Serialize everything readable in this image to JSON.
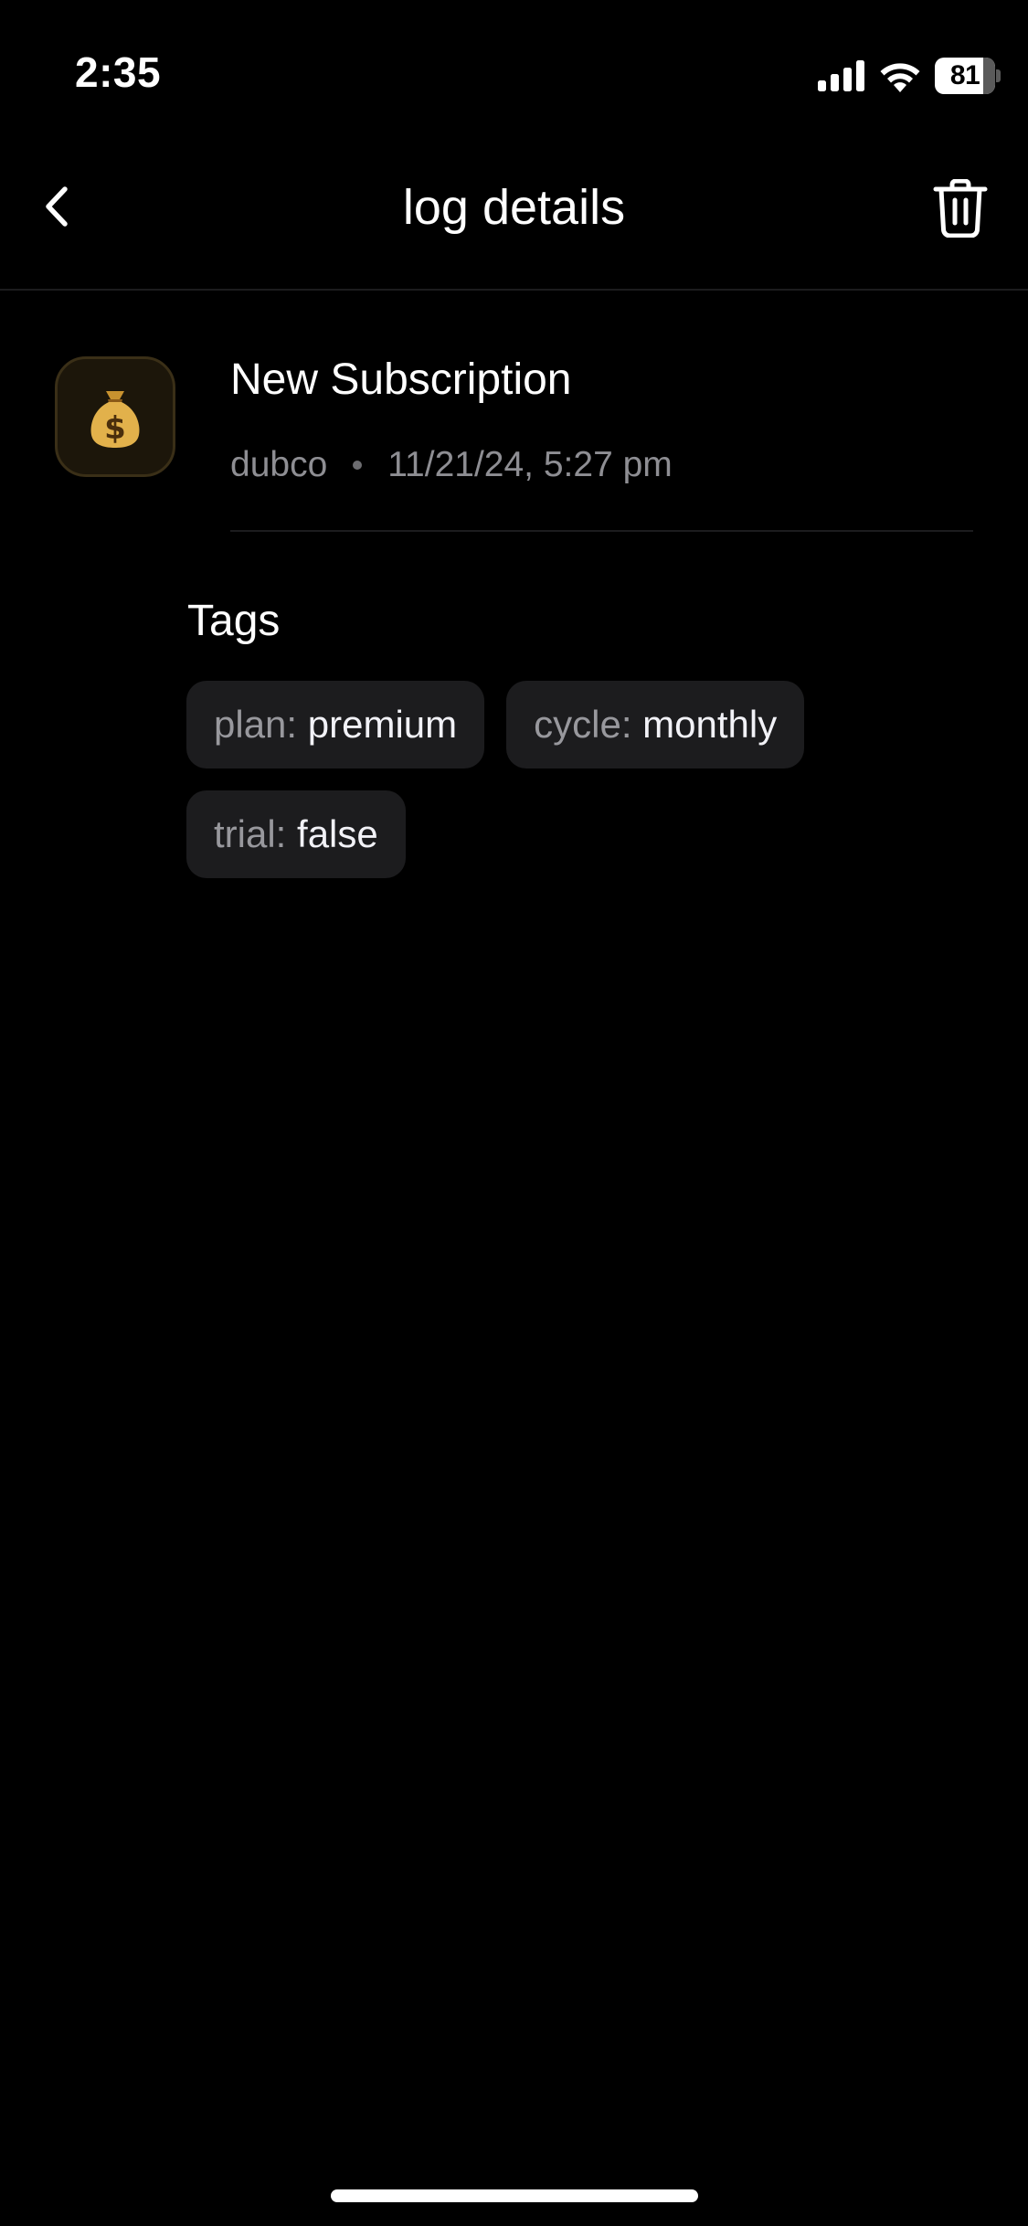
{
  "status_bar": {
    "time": "2:35",
    "battery_level": "81",
    "battery_fraction": 0.81,
    "icons": [
      "cellular-signal-icon",
      "wifi-icon",
      "battery-icon"
    ]
  },
  "header": {
    "title": "log details",
    "back_icon": "chevron-left-icon",
    "delete_icon": "trash-icon"
  },
  "log": {
    "icon": "money-bag-icon",
    "title": "New Subscription",
    "source": "dubco",
    "timestamp": "11/21/24, 5:27 pm"
  },
  "tags": {
    "heading": "Tags",
    "items": [
      {
        "key": "plan:",
        "value": "premium"
      },
      {
        "key": "cycle:",
        "value": "monthly"
      },
      {
        "key": "trial:",
        "value": "false"
      }
    ]
  },
  "colors": {
    "background": "#000000",
    "text": "#ffffff",
    "muted_text": "#8e8e93",
    "chip_background": "#1c1c1e",
    "avatar_background": "#1c160a",
    "money_bag": "#e2b14b"
  }
}
